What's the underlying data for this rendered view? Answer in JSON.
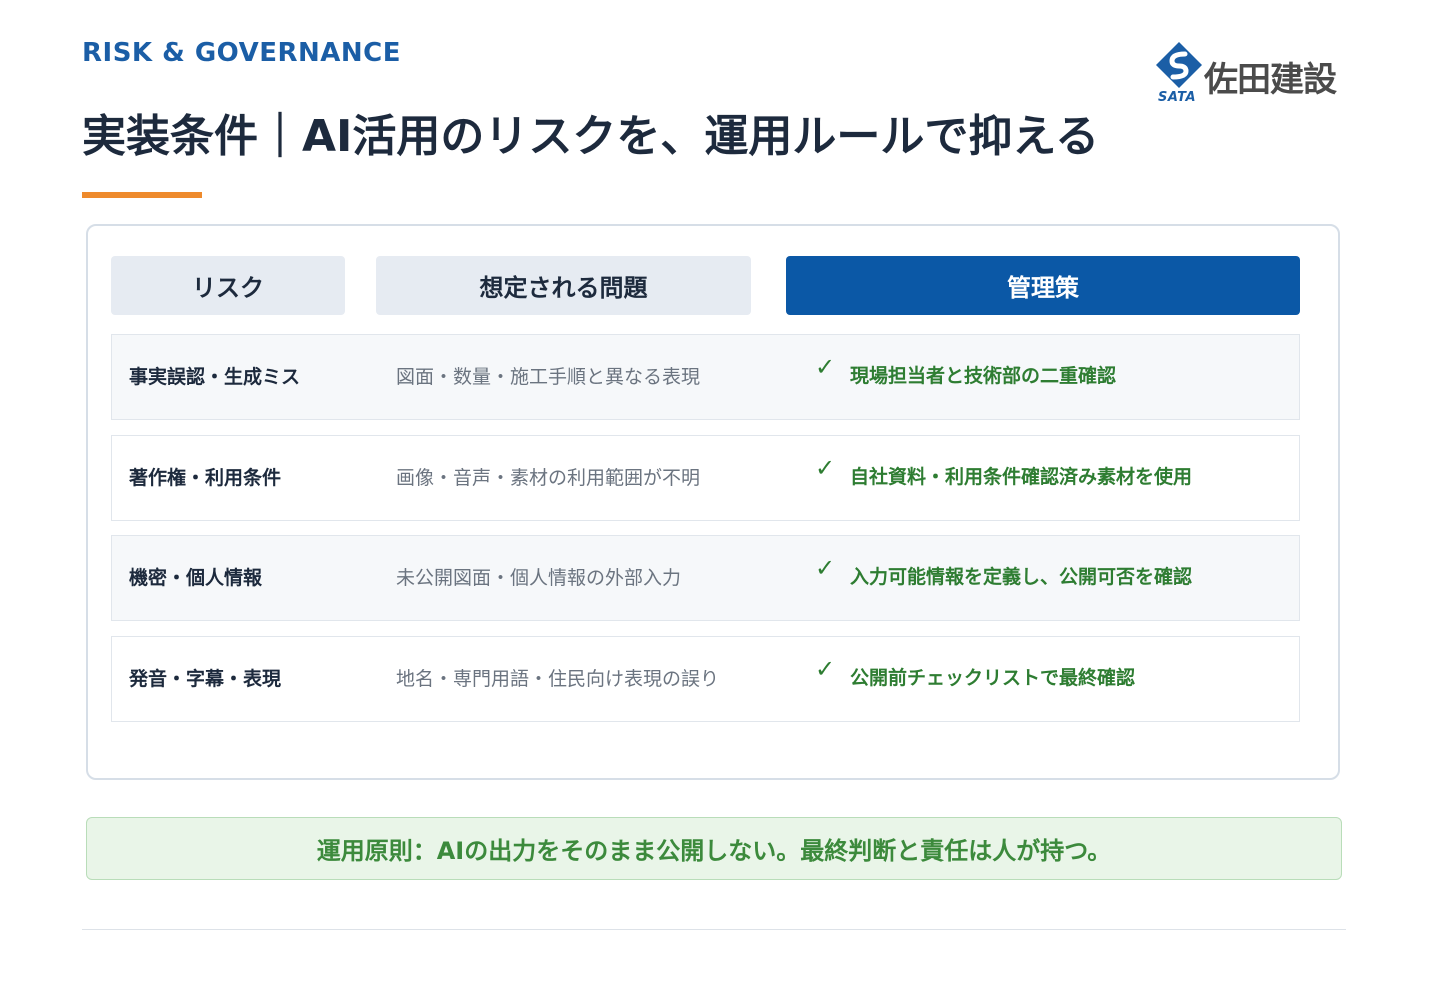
{
  "header": {
    "eyebrow": "RISK & GOVERNANCE",
    "title": "実装条件｜AI活用のリスクを、運用ルールで抑える"
  },
  "logo": {
    "name": "佐田建設",
    "sub": "SATA",
    "colors": {
      "mark": "#1b5ea6",
      "text": "#4b4b4b"
    }
  },
  "table": {
    "headers": {
      "risk": "リスク",
      "problem": "想定される問題",
      "measure": "管理策"
    },
    "check_glyph": "✓",
    "rows": [
      {
        "risk": "事実誤認・生成ミス",
        "problem": "図面・数量・施工手順と異なる表現",
        "measure": "現場担当者と技術部の二重確認"
      },
      {
        "risk": "著作権・利用条件",
        "problem": "画像・音声・素材の利用範囲が不明",
        "measure": "自社資料・利用条件確認済み素材を使用"
      },
      {
        "risk": "機密・個人情報",
        "problem": "未公開図面・個人情報の外部入力",
        "measure": "入力可能情報を定義し、公開可否を確認"
      },
      {
        "risk": "発音・字幕・表現",
        "problem": "地名・専門用語・住民向け表現の誤り",
        "measure": "公開前チェックリストで最終確認"
      }
    ]
  },
  "principle": "運用原則：AIの出力をそのまま公開しない。最終判断と責任は人が持つ。",
  "colors": {
    "accent": "#ee8a2c",
    "brand_blue": "#0b58a6",
    "check_green": "#2e7d32",
    "principle_bg": "#e9f5e8"
  }
}
